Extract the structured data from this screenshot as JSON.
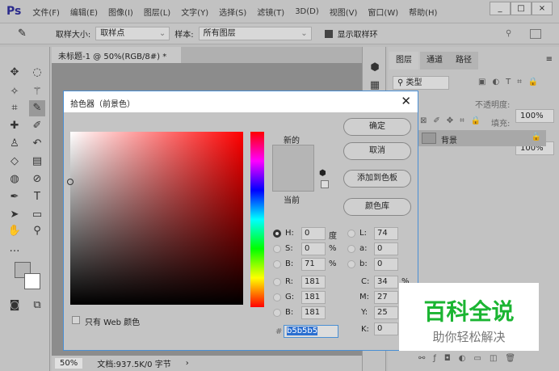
{
  "app": {
    "logo": "Ps",
    "menu": [
      "文件(F)",
      "编辑(E)",
      "图像(I)",
      "图层(L)",
      "文字(Y)",
      "选择(S)",
      "滤镜(T)",
      "3D(D)",
      "视图(V)",
      "窗口(W)",
      "帮助(H)"
    ],
    "window_buttons": [
      "_",
      "□",
      "×"
    ]
  },
  "options": {
    "sample_size_label": "取样大小:",
    "sample_size": "取样点",
    "sample_label": "样本:",
    "sample": "所有图层",
    "show_ring": "显示取样环"
  },
  "document": {
    "tab": "未标题-1 @ 50%(RGB/8#) *",
    "tab_close": "×",
    "zoom": "50%",
    "doc_info": "文档:937.5K/0 字节"
  },
  "panel": {
    "tabs": [
      "图层",
      "通道",
      "路径"
    ],
    "filter": "类型",
    "opacity_label": "不透明度:",
    "opacity": "100%",
    "fill_label": "填充:",
    "fill": "100%",
    "layer": "背景"
  },
  "dialog": {
    "title": "拾色器（前景色）",
    "new_label": "新的",
    "current_label": "当前",
    "current_color": "#b5b5b5",
    "buttons": {
      "ok": "确定",
      "cancel": "取消",
      "add": "添加到色板",
      "library": "颜色库"
    },
    "fields": {
      "H": "0",
      "S": "0",
      "B": "71",
      "R": "181",
      "G": "181",
      "B2": "181",
      "L": "74",
      "a": "0",
      "b": "0",
      "C": "34",
      "M": "27",
      "Y": "25",
      "K": "0",
      "hex": "b5b5b5"
    },
    "units": {
      "deg": "度",
      "pct": "%"
    },
    "labels": {
      "H": "H:",
      "S": "S:",
      "B": "B:",
      "R": "R:",
      "G": "G:",
      "B2": "B:",
      "L": "L:",
      "a": "a:",
      "b": "b:",
      "C": "C:",
      "M": "M:",
      "Y": "Y:",
      "K": "K:",
      "hash": "#"
    },
    "web_only": "只有 Web 颜色"
  },
  "watermark": {
    "title": "百科全说",
    "subtitle": "助你轻松解决"
  }
}
